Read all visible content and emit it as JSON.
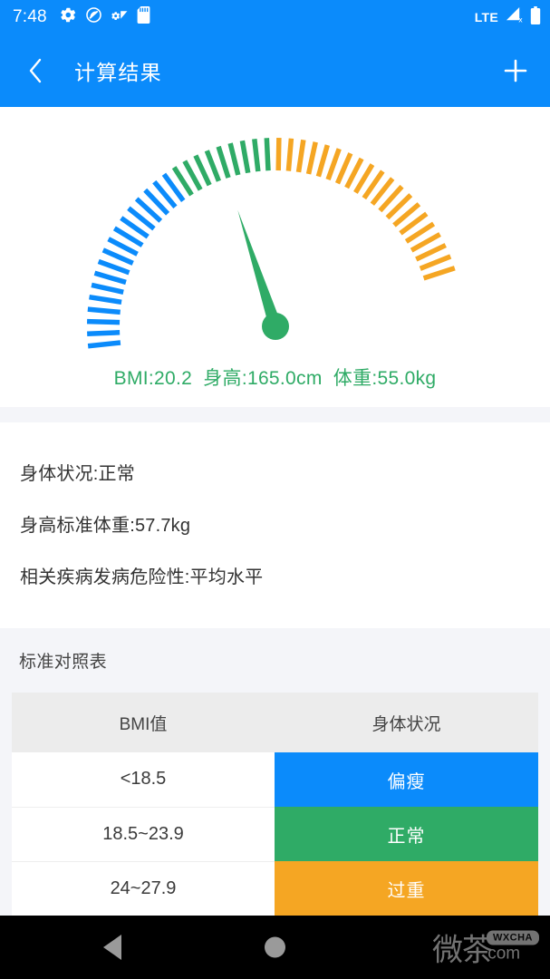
{
  "status_bar": {
    "time": "7:48",
    "network_label": "LTE",
    "left_icons": [
      "gear-icon",
      "do-not-disturb-icon",
      "wifi-settings-icon",
      "sd-card-icon"
    ],
    "right_icons": [
      "signal-no-service-icon",
      "battery-icon"
    ],
    "background_color": "#0b8bfb"
  },
  "app_bar": {
    "back_label": "‹",
    "title": "计算结果",
    "add_label": "+",
    "background_color": "#0b8bfb"
  },
  "gauge": {
    "caption_bmi": "BMI:20.2",
    "caption_height": "身高:165.0cm",
    "caption_weight": "体重:55.0kg",
    "caption_color": "#2fab66",
    "needle_color": "#2fab66",
    "colors": {
      "under": "#0b8bfb",
      "normal": "#2fab66",
      "over": "#f5a623"
    },
    "value": 20.2,
    "needle_angle_deg": 108
  },
  "info": {
    "lines": [
      "身体状况:正常",
      "身高标准体重:57.7kg",
      "相关疾病发病危险性:平均水平"
    ]
  },
  "table_section": {
    "title": "标准对照表",
    "headers": [
      "BMI值",
      "身体状况"
    ],
    "rows": [
      {
        "range": "<18.5",
        "state": "偏瘦",
        "color": "#0b8bfb"
      },
      {
        "range": "18.5~23.9",
        "state": "正常",
        "color": "#2fab66"
      },
      {
        "range": "24~27.9",
        "state": "过重",
        "color": "#f5b košice"
      }
    ]
  },
  "nav_bar": {
    "back_icon": "triangle-back-icon",
    "home_icon": "circle-home-icon",
    "watermark_cn": "微茶",
    "watermark_badge": "WXCHA",
    "watermark_domain": ".com"
  }
}
